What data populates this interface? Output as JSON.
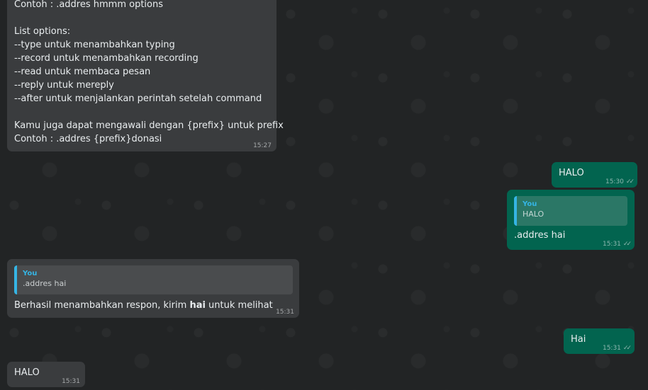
{
  "messages": [
    {
      "direction": "incoming",
      "lines": [
        "Contoh : .addres hmmm options",
        "",
        "List options:",
        "--type untuk menambahkan typing",
        "--record untuk menambahkan recording",
        "--read untuk membaca pesan",
        "--reply untuk mereply",
        "--after untuk menjalankan perintah setelah command",
        "",
        "Kamu juga dapat mengawali dengan {prefix} untuk prefix",
        "Contoh : .addres {prefix}donasi"
      ],
      "time": "15:27"
    },
    {
      "direction": "outgoing",
      "text": "HALO",
      "time": "15:30",
      "status": "read-double-check"
    },
    {
      "direction": "outgoing",
      "quote": {
        "author": "You",
        "text": "HALO"
      },
      "text": ".addres hai",
      "time": "15:31",
      "status": "read-double-check"
    },
    {
      "direction": "incoming",
      "quote": {
        "author": "You",
        "text": ".addres hai"
      },
      "text_before": "Berhasil menambahkan respon, kirim ",
      "text_bold": "hai",
      "text_after": " untuk melihat",
      "time": "15:31"
    },
    {
      "direction": "outgoing",
      "text": "Hai",
      "time": "15:31",
      "status": "read-double-check"
    },
    {
      "direction": "incoming",
      "text": "HALO",
      "time": "15:31"
    }
  ],
  "icons": {
    "tick": "double-check-icon"
  },
  "colors": {
    "background": "#222425",
    "incoming_bubble": "#3a3c3e",
    "outgoing_bubble": "#02644f",
    "quote_accent": "#35b5e5",
    "text": "#e9edef"
  }
}
